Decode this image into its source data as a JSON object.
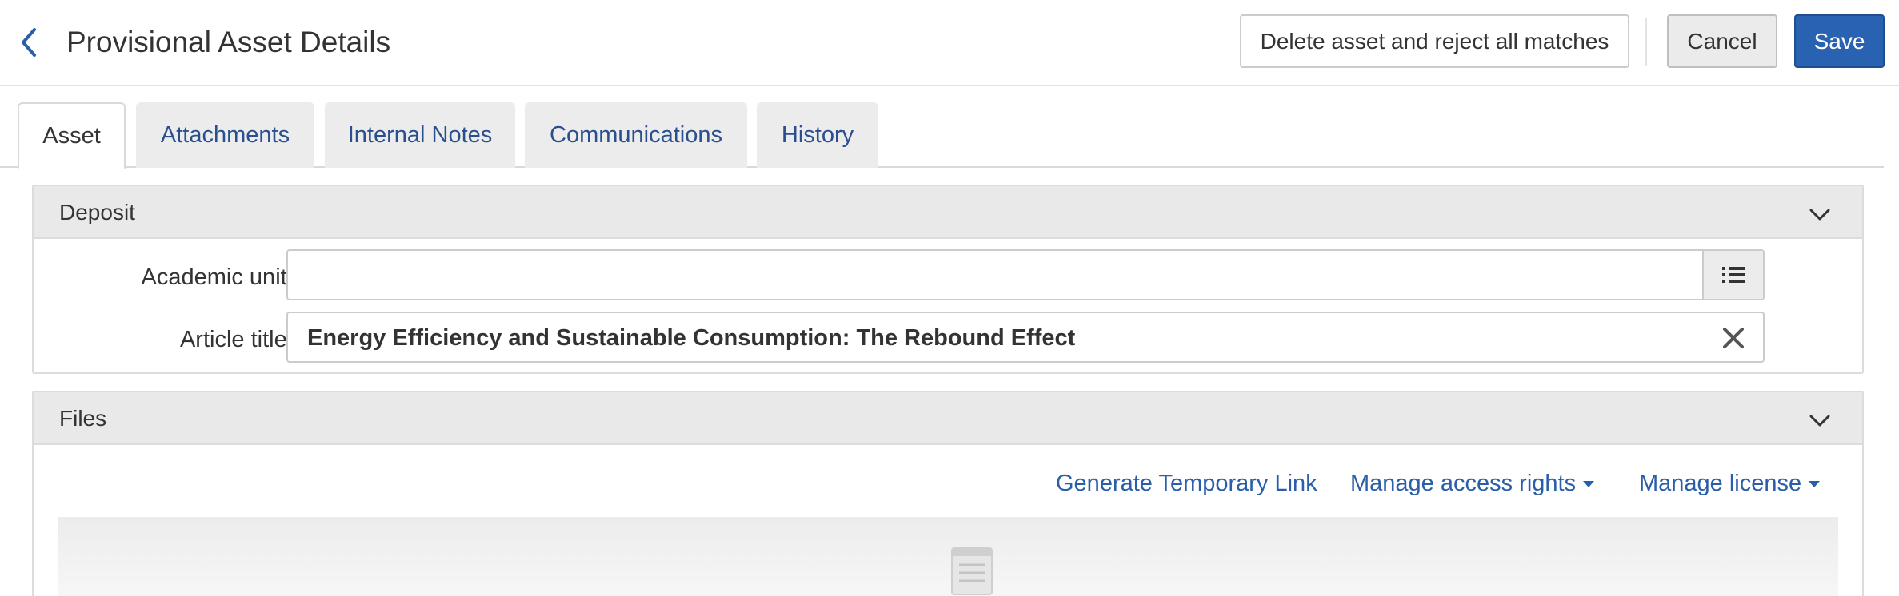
{
  "header": {
    "back_icon": "chevron-left-icon",
    "title": "Provisional Asset Details",
    "delete_label": "Delete asset and reject all matches",
    "cancel_label": "Cancel",
    "save_label": "Save"
  },
  "tabs": [
    {
      "label": "Asset",
      "active": true
    },
    {
      "label": "Attachments",
      "active": false
    },
    {
      "label": "Internal Notes",
      "active": false
    },
    {
      "label": "Communications",
      "active": false
    },
    {
      "label": "History",
      "active": false
    }
  ],
  "deposit": {
    "title": "Deposit",
    "academic_unit": {
      "label": "Academic unit",
      "required_mark": "*",
      "value": ""
    },
    "article_title": {
      "label": "Article title",
      "required_mark": "*",
      "value": "Energy Efficiency and Sustainable Consumption: The Rebound Effect"
    }
  },
  "files": {
    "title": "Files",
    "links": {
      "temp_link": "Generate Temporary Link",
      "access_rights": "Manage access rights",
      "license": "Manage license"
    }
  },
  "colors": {
    "primary": "#2862b0",
    "link": "#2a5ea8",
    "required": "#d0021b"
  }
}
